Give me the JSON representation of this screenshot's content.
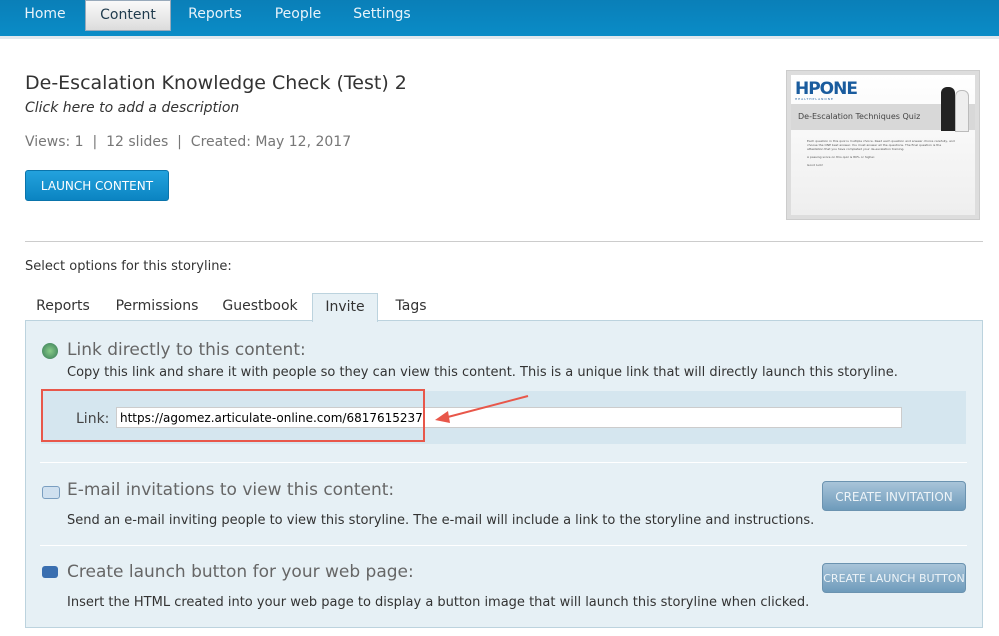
{
  "nav": {
    "items": [
      {
        "label": "Home"
      },
      {
        "label": "Content",
        "active": true
      },
      {
        "label": "Reports"
      },
      {
        "label": "People"
      },
      {
        "label": "Settings"
      }
    ]
  },
  "content": {
    "title": "De-Escalation Knowledge Check (Test) 2",
    "description_placeholder": "Click here to add a description",
    "views": "Views: 1",
    "slides": "12 slides",
    "created": "Created: May 12, 2017",
    "launch_label": "LAUNCH CONTENT"
  },
  "thumbnail": {
    "logo": "HPONE",
    "logo_sub": "HEALTHPLANONE",
    "title": "De-Escalation Techniques Quiz",
    "body": [
      "Each question in this quiz is multiple choice. Read each question and answer choice carefully, and choose the ONE best answer. You must answer all the questions. The final question is the attestation that you have completed your de-escalation training.",
      "A passing score on this quiz is 80% or higher.",
      "Good luck!"
    ]
  },
  "options_label": "Select options for this storyline:",
  "tabs": [
    {
      "label": "Reports"
    },
    {
      "label": "Permissions"
    },
    {
      "label": "Guestbook"
    },
    {
      "label": "Invite",
      "active": true
    },
    {
      "label": "Tags"
    }
  ],
  "invite": {
    "link_section": {
      "heading": "Link directly to this content:",
      "description": "Copy this link and share it with people so they can view this content. This is a unique link that will directly launch this storyline.",
      "link_label": "Link:",
      "link_value": "https://agomez.articulate-online.com/6817615237"
    },
    "email_section": {
      "heading": "E-mail invitations to view this content:",
      "description": "Send an e-mail inviting people to view this storyline. The e-mail will include a link to the storyline and instructions.",
      "button": "CREATE INVITATION"
    },
    "launch_section": {
      "heading": "Create launch button for your web page:",
      "description": "Insert the HTML created into your web page to display a button image that will launch this storyline when clicked.",
      "button": "CREATE LAUNCH BUTTON"
    }
  },
  "colors": {
    "nav": "#0a86c1",
    "annotation": "#e8574a",
    "panel": "#e6f0f5"
  }
}
